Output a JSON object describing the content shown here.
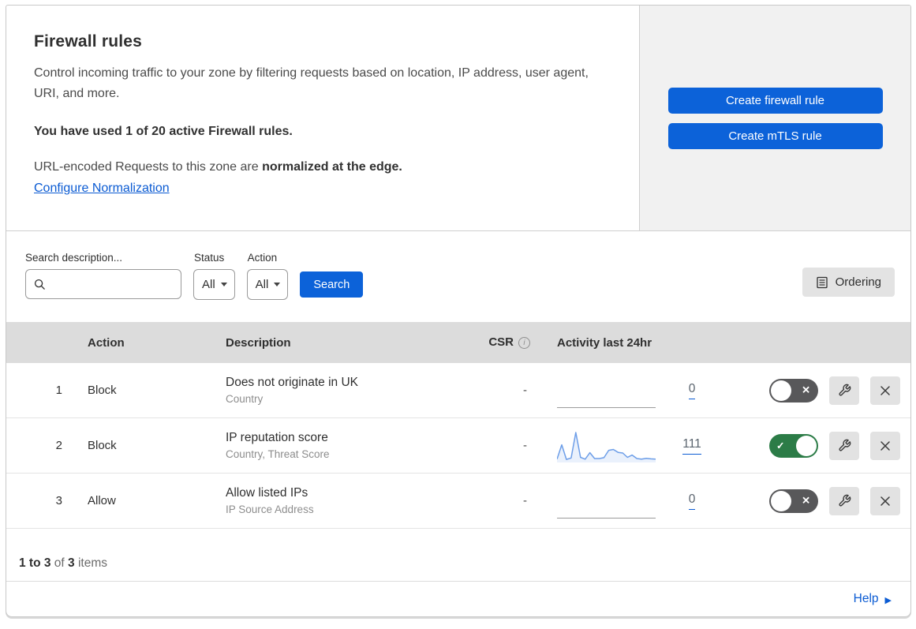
{
  "header": {
    "title": "Firewall rules",
    "description": "Control incoming traffic to your zone by filtering requests based on location, IP address, user agent, URI, and more.",
    "usage_text": "You have used 1 of 20 active Firewall rules.",
    "normalization_prefix": "URL-encoded Requests to this zone are ",
    "normalization_bold": "normalized at the edge.",
    "normalization_link": "Configure Normalization",
    "create_firewall_label": "Create firewall rule",
    "create_mtls_label": "Create mTLS rule"
  },
  "filters": {
    "search_label": "Search description...",
    "search_value": "",
    "status_label": "Status",
    "status_value": "All",
    "action_label": "Action",
    "action_value": "All",
    "search_button": "Search",
    "ordering_button": "Ordering"
  },
  "table": {
    "columns": {
      "action": "Action",
      "description": "Description",
      "csr": "CSR",
      "activity": "Activity last 24hr"
    },
    "rows": [
      {
        "num": "1",
        "action": "Block",
        "description": "Does not originate in UK",
        "fields": "Country",
        "csr": "-",
        "count": "0",
        "enabled": false,
        "sparkline": []
      },
      {
        "num": "2",
        "action": "Block",
        "description": "IP reputation score",
        "fields": "Country, Threat Score",
        "csr": "-",
        "count": "111",
        "enabled": true,
        "sparkline": [
          6,
          55,
          5,
          10,
          97,
          12,
          6,
          28,
          8,
          8,
          11,
          36,
          39,
          29,
          27,
          12,
          20,
          8,
          6,
          9,
          7,
          6
        ]
      },
      {
        "num": "3",
        "action": "Allow",
        "description": "Allow listed IPs",
        "fields": "IP Source Address",
        "csr": "-",
        "count": "0",
        "enabled": false,
        "sparkline": []
      }
    ]
  },
  "pagination": {
    "range": "1 to 3",
    "of_text": "of",
    "total": "3",
    "items_text": "items"
  },
  "footer": {
    "help_label": "Help"
  },
  "icons": {
    "search_glyph": "magnifier",
    "info_glyph": "i",
    "ordering_glyph": "list-page",
    "wrench_glyph": "wrench",
    "delete_glyph": "x",
    "toggle_on_glyph": "✓",
    "toggle_off_glyph": "✕",
    "help_arrow_glyph": "▶",
    "dropdown_caret_glyph": "caret-down"
  },
  "colors": {
    "primary_blue": "#0c62d9",
    "link_blue": "#0b5bd3",
    "toggle_on_green": "#2c7c47",
    "toggle_off_gray": "#58585a",
    "panel_gray": "#f1f1f1",
    "table_header_gray": "#dcdcdc",
    "sparkline_blue": "#6d9ee8"
  }
}
